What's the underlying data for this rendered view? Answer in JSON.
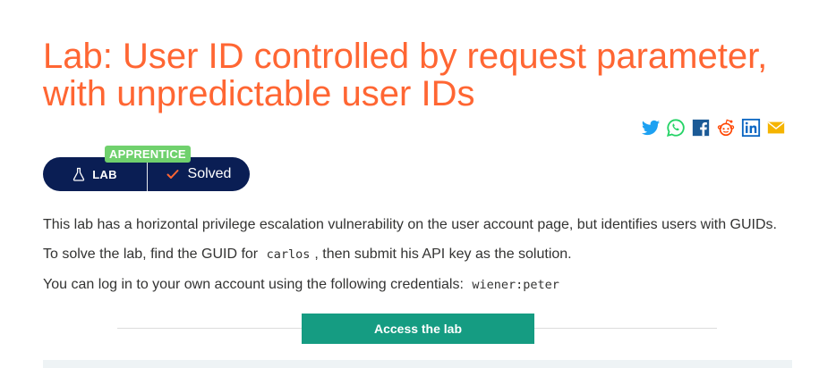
{
  "page": {
    "title": "Lab: User ID controlled by request parameter, with unpredictable user IDs"
  },
  "share": {
    "icons": [
      "twitter-icon",
      "whatsapp-icon",
      "facebook-icon",
      "reddit-icon",
      "linkedin-icon",
      "email-icon"
    ]
  },
  "lab": {
    "level": "APPRENTICE",
    "label": "LAB",
    "status": "Solved"
  },
  "description": {
    "p1": "This lab has a horizontal privilege escalation vulnerability on the user account page, but identifies users with GUIDs.",
    "p2_before": "To solve the lab, find the GUID for",
    "p2_code": "carlos",
    "p2_after": ", then submit his API key as the solution.",
    "p3_before": "You can log in to your own account using the following credentials:",
    "p3_code": "wiener:peter"
  },
  "actions": {
    "access_label": "Access the lab"
  },
  "colors": {
    "title": "#ff6633",
    "pill": "#0a1e54",
    "level_badge": "#70d16d",
    "access_button": "#159c82",
    "check": "#ff6633"
  }
}
